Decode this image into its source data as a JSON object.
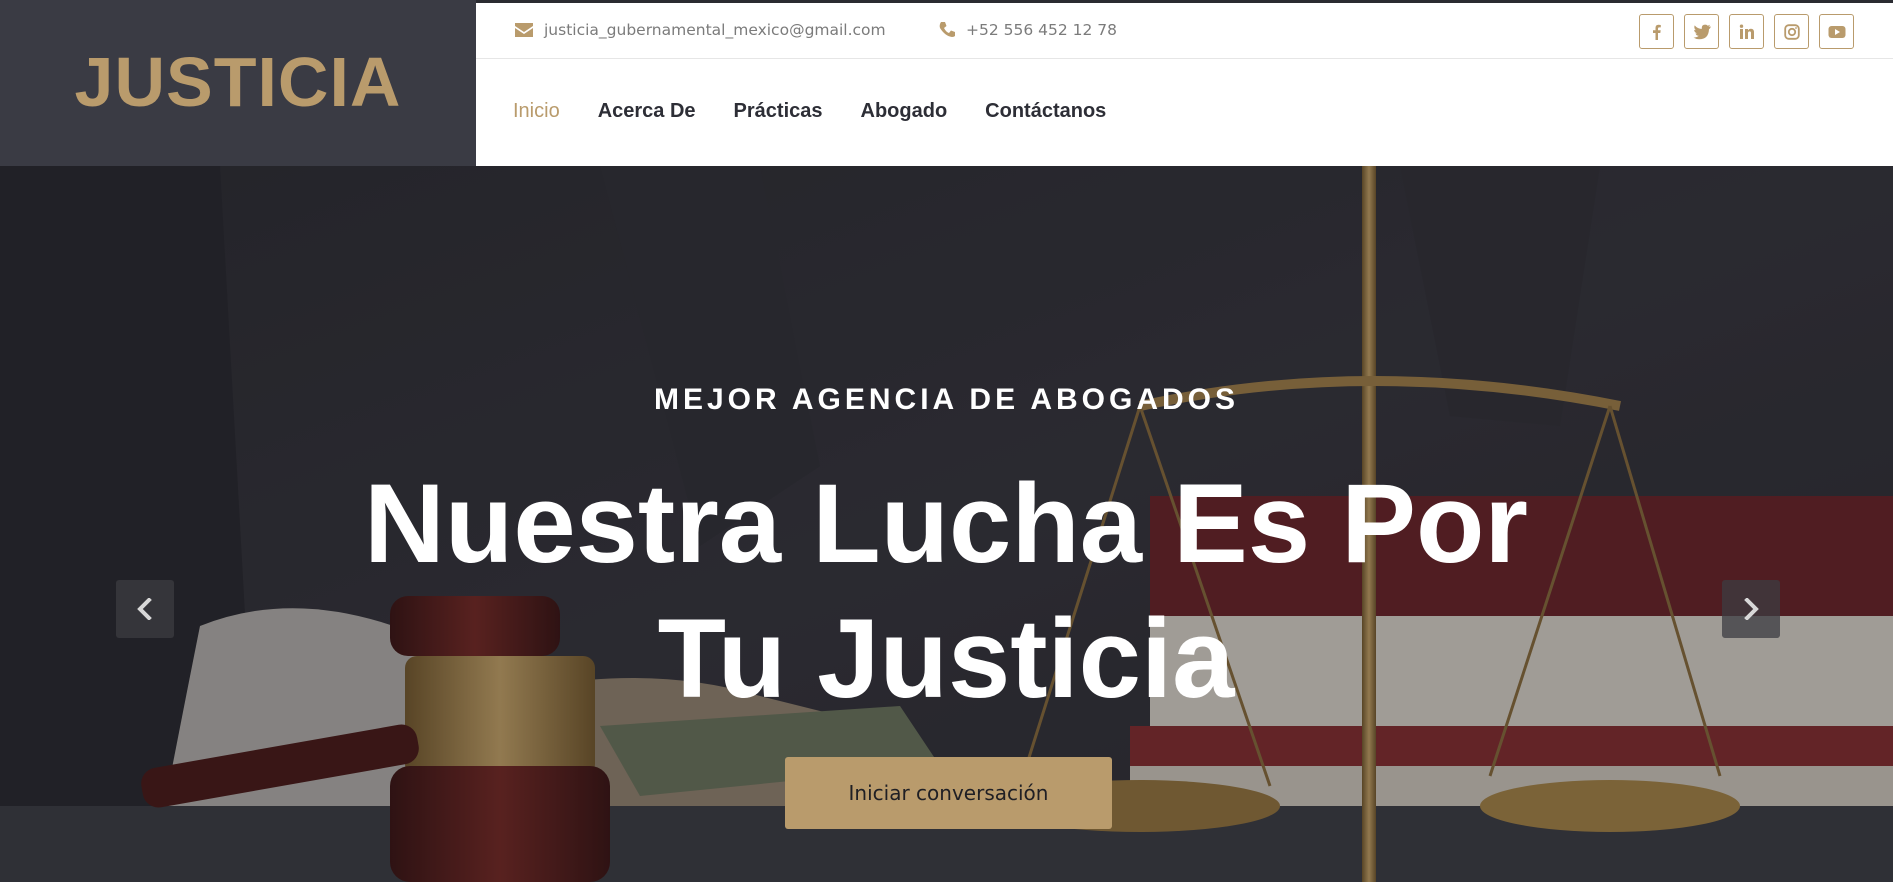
{
  "brand": {
    "logo_text": "JUSTICIA",
    "accent_color": "#b99b6c",
    "logo_bg": "#3a3b44"
  },
  "contact": {
    "email": "justicia_gubernamental_mexico@gmail.com",
    "email_icon": "envelope-icon",
    "phone": "+52 556 452 12 78",
    "phone_icon": "phone-icon"
  },
  "social": [
    {
      "name": "facebook",
      "icon": "facebook-icon"
    },
    {
      "name": "twitter",
      "icon": "twitter-icon"
    },
    {
      "name": "linkedin",
      "icon": "linkedin-icon"
    },
    {
      "name": "instagram",
      "icon": "instagram-icon"
    },
    {
      "name": "youtube",
      "icon": "youtube-icon"
    }
  ],
  "nav": {
    "items": [
      {
        "label": "Inicio",
        "active": true
      },
      {
        "label": "Acerca De",
        "active": false
      },
      {
        "label": "Prácticas",
        "active": false
      },
      {
        "label": "Abogado",
        "active": false
      },
      {
        "label": "Contáctanos",
        "active": false
      }
    ]
  },
  "hero": {
    "subtitle": "MEJOR AGENCIA DE ABOGADOS",
    "title_line1": "Nuestra Lucha Es Por",
    "title_line2": "Tu Justicia",
    "button_label": "Iniciar conversación",
    "prev_icon": "chevron-left-icon",
    "next_icon": "chevron-right-icon",
    "background": "justice-scales-gavel-photo"
  }
}
